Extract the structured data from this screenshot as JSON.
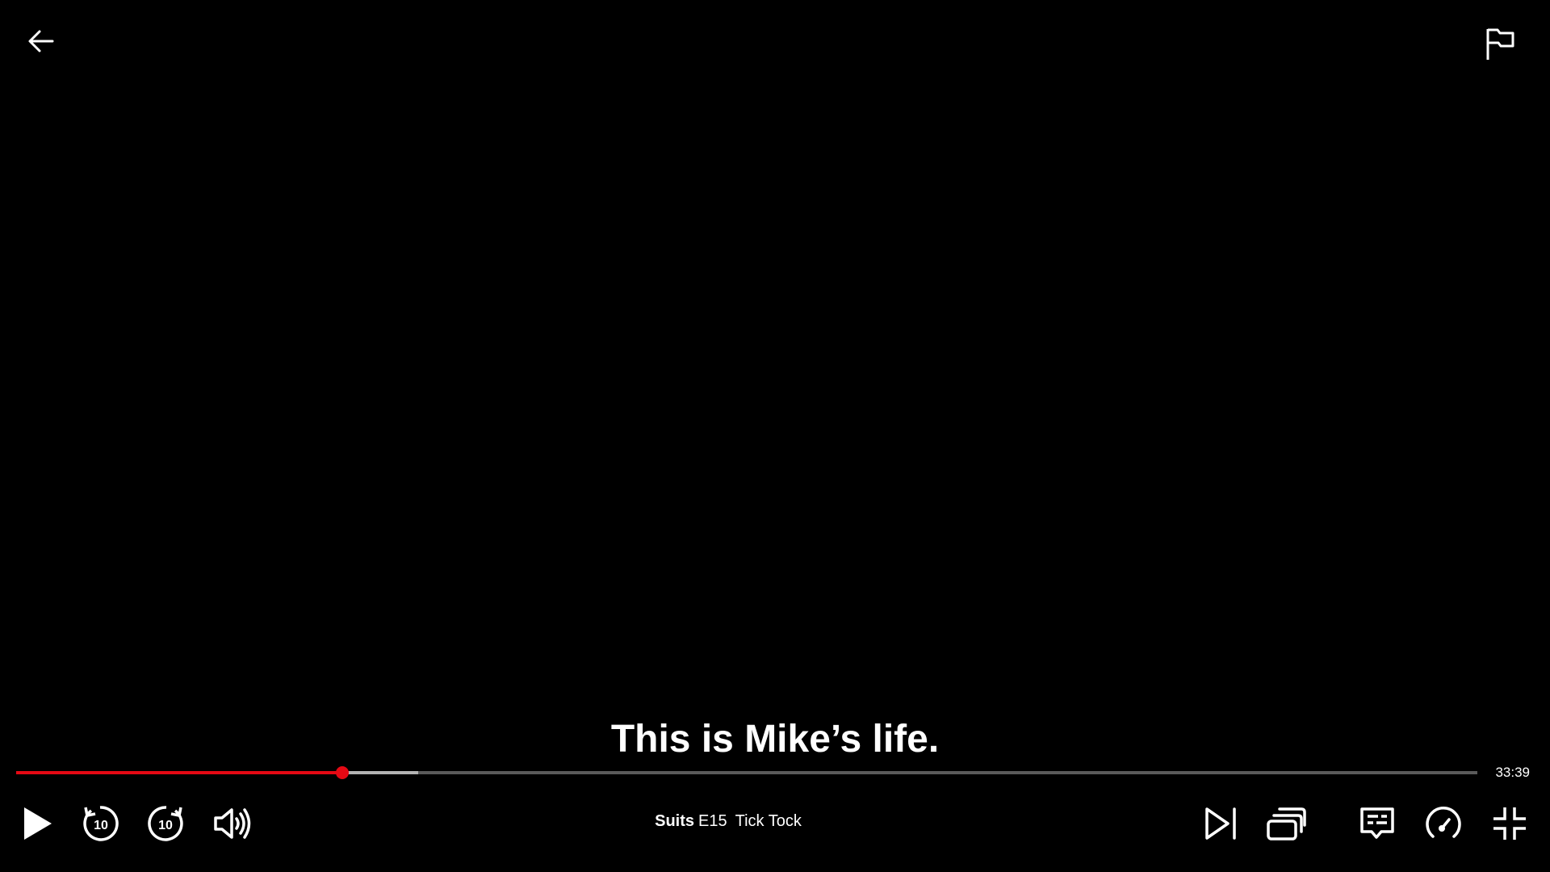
{
  "player": {
    "subtitle": "This is Mike’s life.",
    "time_remaining": "33:39",
    "progress": {
      "played_fraction": 0.223,
      "buffered_fraction": 0.275
    },
    "title": {
      "show": "Suits",
      "episode": "E15",
      "episode_title": "Tick Tock"
    },
    "accent_color": "#e50914",
    "icons": {
      "back": "arrow-left-icon",
      "report": "flag-icon",
      "play": "play-icon",
      "rewind": "rewind-10-icon",
      "forward": "forward-10-icon",
      "volume": "volume-icon",
      "next": "next-episode-icon",
      "episodes": "episodes-icon",
      "subtitles": "subtitles-icon",
      "speed": "playback-speed-icon",
      "fullscreen": "exit-fullscreen-icon"
    },
    "rewind_label": "10",
    "forward_label": "10"
  }
}
